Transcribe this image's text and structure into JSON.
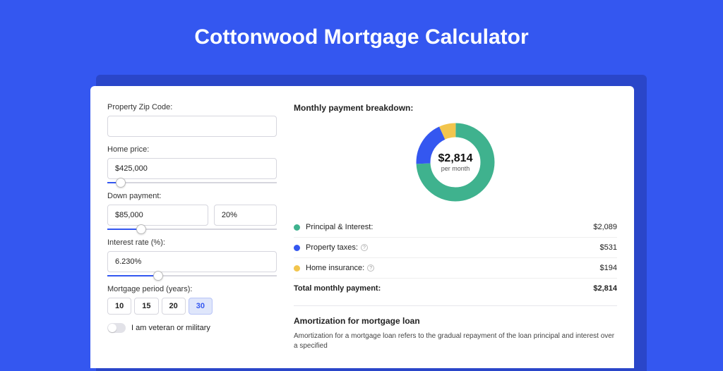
{
  "title": "Cottonwood Mortgage Calculator",
  "form": {
    "zip": {
      "label": "Property Zip Code:",
      "value": ""
    },
    "price": {
      "label": "Home price:",
      "value": "$425,000",
      "slider_pct": 8
    },
    "down": {
      "label": "Down payment:",
      "value": "$85,000",
      "pct": "20%",
      "slider_pct": 20
    },
    "rate": {
      "label": "Interest rate (%):",
      "value": "6.230%",
      "slider_pct": 30
    },
    "period": {
      "label": "Mortgage period (years):",
      "options": [
        "10",
        "15",
        "20",
        "30"
      ],
      "selected": "30"
    },
    "veteran_label": "I am veteran or military",
    "veteran_on": false
  },
  "results": {
    "header": "Monthly payment breakdown:",
    "donut_amount": "$2,814",
    "donut_sub": "per month",
    "items": [
      {
        "label": "Principal & Interest:",
        "value": "$2,089",
        "color": "#3fb28e",
        "info": false
      },
      {
        "label": "Property taxes:",
        "value": "$531",
        "color": "#3457f0",
        "info": true
      },
      {
        "label": "Home insurance:",
        "value": "$194",
        "color": "#f2c54d",
        "info": true
      }
    ],
    "total_label": "Total monthly payment:",
    "total_value": "$2,814"
  },
  "amortization": {
    "title": "Amortization for mortgage loan",
    "text": "Amortization for a mortgage loan refers to the gradual repayment of the loan principal and interest over a specified"
  },
  "chart_data": {
    "type": "pie",
    "title": "Monthly payment breakdown",
    "series": [
      {
        "name": "Principal & Interest",
        "value": 2089,
        "color": "#3fb28e"
      },
      {
        "name": "Property taxes",
        "value": 531,
        "color": "#3457f0"
      },
      {
        "name": "Home insurance",
        "value": 194,
        "color": "#f2c54d"
      }
    ],
    "total": 2814,
    "center_label": "$2,814 per month"
  }
}
